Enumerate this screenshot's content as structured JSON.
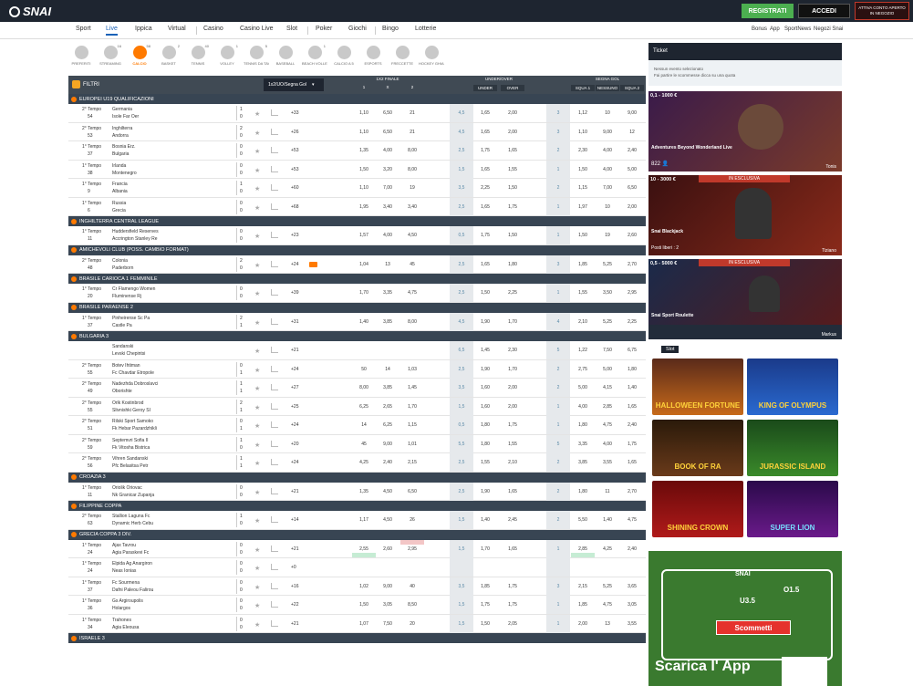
{
  "header": {
    "logo": "SNAI",
    "register": "REGISTRATI",
    "login": "ACCEDI",
    "activate": "ATTIVA CONTO APERTO IN NEGOZIO"
  },
  "nav": {
    "items": [
      "Sport",
      "Live",
      "Ippica",
      "Virtual",
      "Casino",
      "Casino Live",
      "Slot",
      "Poker",
      "Giochi",
      "Bingo",
      "Lotterie"
    ],
    "right": [
      "Bonus",
      "App",
      "SportNews",
      "Negozi Snai"
    ]
  },
  "sports": [
    {
      "label": "PREFERITI",
      "count": ""
    },
    {
      "label": "STREAMING",
      "count": "16"
    },
    {
      "label": "CALCIO",
      "count": "58"
    },
    {
      "label": "BASKET",
      "count": "2"
    },
    {
      "label": "TENNIS",
      "count": "40"
    },
    {
      "label": "VOLLEY",
      "count": "1"
    },
    {
      "label": "TENNIS DA TAVOLO",
      "count": "5"
    },
    {
      "label": "BASEBALL",
      "count": ""
    },
    {
      "label": "BEACH VOLLEY",
      "count": "1"
    },
    {
      "label": "CALCIO A 5",
      "count": ""
    },
    {
      "label": "ESPORTS",
      "count": ""
    },
    {
      "label": "FRECCETTE",
      "count": ""
    },
    {
      "label": "HOCKEY GHIACCIO",
      "count": ""
    }
  ],
  "filters": {
    "label": "FILTRI",
    "dropdown": "1x2/UO/Segna Gol"
  },
  "columns": {
    "g1": "1X2 FINALE",
    "g2": "UNDER/OVER",
    "g3": "SEGNA GOL",
    "c1": "1",
    "cx": "X",
    "c2": "2",
    "under": "UNDER",
    "over": "OVER",
    "sq1": "SQUA 1",
    "nessuno": "NESSUNO",
    "sq2": "SQUA 2"
  },
  "competitions": [
    {
      "name": "EUROPEI U19 QUALIFICAZIONI",
      "events": [
        {
          "period": "2° Tempo",
          "min": "54",
          "home": "Germania",
          "away": "Isole Far Oer",
          "sh": "1",
          "sa": "0",
          "n": "+33",
          "o1": "1,10",
          "ox": "6,50",
          "o2": "21",
          "line": "4,5",
          "u": "1,65",
          "ov": "2,00",
          "g": "3",
          "g1": "1,12",
          "gn": "10",
          "g2": "9,00"
        },
        {
          "period": "2° Tempo",
          "min": "53",
          "home": "Inghilterra",
          "away": "Andorra",
          "sh": "2",
          "sa": "0",
          "n": "+26",
          "o1": "1,10",
          "ox": "6,50",
          "o2": "21",
          "line": "4,5",
          "u": "1,65",
          "ov": "2,00",
          "g": "3",
          "g1": "1,10",
          "gn": "9,00",
          "g2": "12"
        },
        {
          "period": "1° Tempo",
          "min": "37",
          "home": "Bosnia Erz.",
          "away": "Bulgaria",
          "sh": "0",
          "sa": "0",
          "n": "+53",
          "o1": "1,35",
          "ox": "4,00",
          "o2": "8,00",
          "line": "2,5",
          "u": "1,75",
          "ov": "1,65",
          "g": "2",
          "g1": "2,30",
          "gn": "4,00",
          "g2": "2,40"
        },
        {
          "period": "1° Tempo",
          "min": "38",
          "home": "Irlanda",
          "away": "Montenegro",
          "sh": "0",
          "sa": "0",
          "n": "+53",
          "o1": "1,50",
          "ox": "3,20",
          "o2": "8,00",
          "line": "1,5",
          "u": "1,65",
          "ov": "1,55",
          "g": "1",
          "g1": "1,50",
          "gn": "4,00",
          "g2": "5,00"
        },
        {
          "period": "1° Tempo",
          "min": "9",
          "home": "Francia",
          "away": "Albania",
          "sh": "1",
          "sa": "0",
          "n": "+60",
          "o1": "1,10",
          "ox": "7,00",
          "o2": "19",
          "line": "3,5",
          "u": "2,25",
          "ov": "1,50",
          "g": "2",
          "g1": "1,15",
          "gn": "7,00",
          "g2": "6,50"
        },
        {
          "period": "1° Tempo",
          "min": "6",
          "home": "Russia",
          "away": "Grecia",
          "sh": "0",
          "sa": "0",
          "n": "+68",
          "o1": "1,95",
          "ox": "3,40",
          "o2": "3,40",
          "line": "2,5",
          "u": "1,65",
          "ov": "1,75",
          "g": "1",
          "g1": "1,97",
          "gn": "10",
          "g2": "2,00"
        }
      ]
    },
    {
      "name": "INGHILTERRA CENTRAL LEAGUE",
      "events": [
        {
          "period": "1° Tempo",
          "min": "11",
          "home": "Huddersfield Reserves",
          "away": "Accrington Stanley Re",
          "sh": "0",
          "sa": "0",
          "n": "+23",
          "o1": "1,57",
          "ox": "4,00",
          "o2": "4,50",
          "line": "0,5",
          "u": "1,75",
          "ov": "1,50",
          "g": "1",
          "g1": "1,50",
          "gn": "19",
          "g2": "2,60"
        }
      ]
    },
    {
      "name": "AMICHEVOLI CLUB (POSS. CAMBIO FORMAT)",
      "events": [
        {
          "period": "2° Tempo",
          "min": "48",
          "home": "Colonia",
          "away": "Paderborn",
          "sh": "2",
          "sa": "0",
          "n": "+24",
          "cam": true,
          "o1": "1,04",
          "ox": "13",
          "o2": "45",
          "line": "2,5",
          "u": "1,65",
          "ov": "1,80",
          "g": "3",
          "g1": "1,85",
          "gn": "5,25",
          "g2": "2,70"
        }
      ]
    },
    {
      "name": "BRASILE CARIOCA 1 FEMMINILE",
      "events": [
        {
          "period": "1° Tempo",
          "min": "20",
          "home": "Cr Flamengo Women",
          "away": "Fluminense Rj",
          "sh": "0",
          "sa": "0",
          "n": "+39",
          "o1": "1,70",
          "ox": "3,35",
          "o2": "4,75",
          "line": "2,5",
          "u": "1,50",
          "ov": "2,25",
          "g": "1",
          "g1": "1,55",
          "gn": "3,50",
          "g2": "2,95"
        }
      ]
    },
    {
      "name": "BRASILE PARAENSE 2",
      "events": [
        {
          "period": "1° Tempo",
          "min": "37",
          "home": "Pinheirense Sc Pa",
          "away": "Castle Pa",
          "sh": "2",
          "sa": "1",
          "n": "+31",
          "o1": "1,40",
          "ox": "3,85",
          "o2": "8,00",
          "line": "4,5",
          "u": "1,90",
          "ov": "1,70",
          "g": "4",
          "g1": "2,10",
          "gn": "5,25",
          "g2": "2,25"
        }
      ]
    },
    {
      "name": "BULGARIA 3",
      "events": [
        {
          "period": "",
          "min": "",
          "home": "Sandanski",
          "away": "Levski Chepintsi",
          "sh": "",
          "sa": "",
          "n": "+21",
          "o1": "",
          "ox": "",
          "o2": "",
          "line": "6,5",
          "u": "1,45",
          "ov": "2,30",
          "g": "5",
          "g1": "1,22",
          "gn": "7,50",
          "g2": "6,75"
        },
        {
          "period": "2° Tempo",
          "min": "55",
          "home": "Botev Ihtiman",
          "away": "Fc Chavdar Etropole",
          "sh": "0",
          "sa": "1",
          "n": "+24",
          "o1": "50",
          "ox": "14",
          "o2": "1,03",
          "line": "2,5",
          "u": "1,90",
          "ov": "1,70",
          "g": "2",
          "g1": "2,75",
          "gn": "5,00",
          "g2": "1,80"
        },
        {
          "period": "2° Tempo",
          "min": "49",
          "home": "Nadezhda Dobroslavci",
          "away": "Oborishte",
          "sh": "1",
          "sa": "1",
          "n": "+27",
          "o1": "8,00",
          "ox": "3,85",
          "o2": "1,45",
          "line": "3,5",
          "u": "1,60",
          "ov": "2,00",
          "g": "2",
          "g1": "5,00",
          "gn": "4,15",
          "g2": "1,40"
        },
        {
          "period": "2° Tempo",
          "min": "55",
          "home": "Orlk Kostinbrod",
          "away": "Slivnishki Geroy SI",
          "sh": "2",
          "sa": "1",
          "n": "+25",
          "o1": "6,25",
          "ox": "2,65",
          "o2": "1,70",
          "line": "1,5",
          "u": "1,60",
          "ov": "2,00",
          "g": "1",
          "g1": "4,00",
          "gn": "2,85",
          "g2": "1,65"
        },
        {
          "period": "2° Tempo",
          "min": "51",
          "home": "Rilski Sport Samoko",
          "away": "Fk Hebar Pazardzhikli",
          "sh": "0",
          "sa": "1",
          "n": "+24",
          "o1": "14",
          "ox": "6,25",
          "o2": "1,15",
          "line": "0,5",
          "u": "1,80",
          "ov": "1,75",
          "g": "1",
          "g1": "1,80",
          "gn": "4,75",
          "g2": "2,40"
        },
        {
          "period": "2° Tempo",
          "min": "59",
          "home": "Septemvri Sofia II",
          "away": "Fk Vitosha Bistrica",
          "sh": "1",
          "sa": "0",
          "n": "+20",
          "o1": "45",
          "ox": "9,00",
          "o2": "1,01",
          "line": "5,5",
          "u": "1,80",
          "ov": "1,55",
          "g": "5",
          "g1": "3,35",
          "gn": "4,00",
          "g2": "1,75"
        },
        {
          "period": "2° Tempo",
          "min": "56",
          "home": "Vihren Sandanski",
          "away": "Pfc Belasitsa Petr",
          "sh": "1",
          "sa": "1",
          "n": "+24",
          "o1": "4,25",
          "ox": "2,40",
          "o2": "2,15",
          "line": "2,5",
          "u": "1,55",
          "ov": "2,10",
          "g": "2",
          "g1": "3,85",
          "gn": "3,55",
          "g2": "1,65"
        }
      ]
    },
    {
      "name": "CROAZIA 3",
      "events": [
        {
          "period": "1° Tempo",
          "min": "11",
          "home": "Oriolik Oriovac",
          "away": "Nk Granicar Zupanja",
          "sh": "0",
          "sa": "0",
          "n": "+21",
          "o1": "1,35",
          "ox": "4,50",
          "o2": "6,50",
          "line": "2,5",
          "u": "1,90",
          "ov": "1,65",
          "g": "2",
          "g1": "1,80",
          "gn": "11",
          "g2": "2,70"
        }
      ]
    },
    {
      "name": "FILIPPINE COPPA",
      "events": [
        {
          "period": "2° Tempo",
          "min": "63",
          "home": "Stallion Laguna Fc",
          "away": "Dynamic Herb Cebu",
          "sh": "1",
          "sa": "0",
          "n": "+14",
          "o1": "1,17",
          "ox": "4,50",
          "o2": "26",
          "line": "1,5",
          "u": "1,40",
          "ov": "2,45",
          "g": "2",
          "g1": "5,50",
          "gn": "1,40",
          "g2": "4,75"
        }
      ]
    },
    {
      "name": "GRECIA COPPA 3 DIV.",
      "events": [
        {
          "period": "1° Tempo",
          "min": "24",
          "home": "Ajax Tavrou",
          "away": "Agia Paraskevi Fc",
          "sh": "0",
          "sa": "0",
          "n": "+21",
          "o1": "2,55",
          "ox": "2,60",
          "o2": "2,95",
          "line": "1,5",
          "u": "1,70",
          "ov": "1,65",
          "g": "1",
          "g1": "2,85",
          "gn": "4,25",
          "g2": "2,40",
          "hl": true
        },
        {
          "period": "1° Tempo",
          "min": "24",
          "home": "Elpida Ag Anargiron",
          "away": "Neas Ionias",
          "sh": "0",
          "sa": "0",
          "n": "+0",
          "o1": "",
          "ox": "",
          "o2": "",
          "line": "",
          "u": "",
          "ov": "",
          "g": "",
          "g1": "",
          "gn": "",
          "g2": ""
        },
        {
          "period": "1° Tempo",
          "min": "37",
          "home": "Fc Sourmena",
          "away": "Dafni Paleou Falirou",
          "sh": "0",
          "sa": "0",
          "n": "+16",
          "o1": "1,02",
          "ox": "9,00",
          "o2": "40",
          "line": "3,5",
          "u": "1,85",
          "ov": "1,75",
          "g": "3",
          "g1": "2,15",
          "gn": "5,25",
          "g2": "3,65"
        },
        {
          "period": "1° Tempo",
          "min": "36",
          "home": "Gs Argiroupolis",
          "away": "Holargos",
          "sh": "0",
          "sa": "0",
          "n": "+22",
          "o1": "1,50",
          "ox": "3,05",
          "o2": "8,50",
          "line": "1,5",
          "u": "1,75",
          "ov": "1,75",
          "g": "1",
          "g1": "1,85",
          "gn": "4,75",
          "g2": "3,05"
        },
        {
          "period": "1° Tempo",
          "min": "34",
          "home": "Trahones",
          "away": "Agia Eleousa",
          "sh": "0",
          "sa": "0",
          "n": "+21",
          "o1": "1,07",
          "ox": "7,50",
          "o2": "20",
          "line": "1,5",
          "u": "1,50",
          "ov": "2,05",
          "g": "1",
          "g1": "2,00",
          "gn": "13",
          "g2": "3,55"
        }
      ]
    },
    {
      "name": "ISRAELE 3",
      "events": []
    }
  ],
  "ticket": {
    "title": "Ticket",
    "empty": "Nessun evento selezionato",
    "hint": "Fai partire le scommesse dicca su una quota"
  },
  "live_games": [
    {
      "amount": "0,1 - 1000 €",
      "title": "Adventures Beyond Wonderland Live",
      "players": "822",
      "dealer": "Tonis",
      "exclusive": ""
    },
    {
      "amount": "10 - 3000 €",
      "title": "Snai Blackjack",
      "players": "Posti liberi : 2",
      "dealer": "Tiziano",
      "exclusive": "IN ESCLUSIVA"
    },
    {
      "amount": "0,5 - 5000 €",
      "title": "Snai Sport Roulette",
      "players": "",
      "dealer": "Markus",
      "exclusive": "IN ESCLUSIVA"
    }
  ],
  "slot_section": {
    "title": "Slot",
    "games": [
      "HALLOWEEN FORTUNE",
      "KING OF OLYMPUS",
      "BOOK OF RA",
      "JURASSIC ISLAND",
      "SHINING CROWN",
      "SUPER LION"
    ]
  },
  "promo": {
    "cta": "Scommetti",
    "download": "Scarica l' App",
    "logo": "SNAI",
    "u35": "U3.5",
    "o15": "O1.5"
  }
}
